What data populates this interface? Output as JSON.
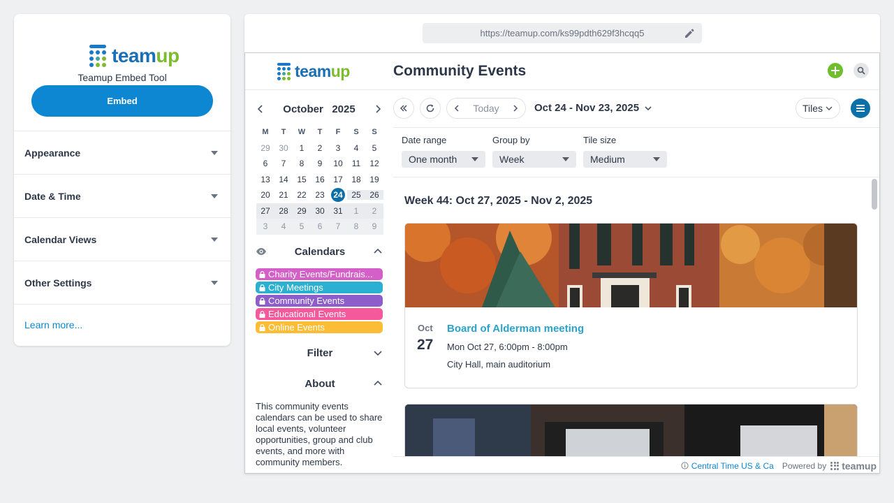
{
  "embed_tool": {
    "logo_text_part1": "team",
    "logo_text_part2": "up",
    "subtitle": "Teamup Embed Tool",
    "embed_label": "Embed",
    "sections": [
      {
        "label": "Appearance"
      },
      {
        "label": "Date & Time"
      },
      {
        "label": "Calendar Views"
      },
      {
        "label": "Other Settings"
      }
    ],
    "learn_more": "Learn more..."
  },
  "preview": {
    "url": "https://teamup.com/ks99pdth629f3hcqq5"
  },
  "calendar": {
    "title": "Community Events",
    "mini_cal": {
      "month": "October",
      "year": "2025",
      "dow": [
        "M",
        "T",
        "W",
        "T",
        "F",
        "S",
        "S"
      ],
      "weeks": [
        [
          "29",
          "30",
          "1",
          "2",
          "3",
          "4",
          "5"
        ],
        [
          "6",
          "7",
          "8",
          "9",
          "10",
          "11",
          "12"
        ],
        [
          "13",
          "14",
          "15",
          "16",
          "17",
          "18",
          "19"
        ],
        [
          "20",
          "21",
          "22",
          "23",
          "24",
          "25",
          "26"
        ],
        [
          "27",
          "28",
          "29",
          "30",
          "31",
          "1",
          "2"
        ],
        [
          "3",
          "4",
          "5",
          "6",
          "7",
          "8",
          "9"
        ]
      ],
      "today": "24"
    },
    "calendars_heading": "Calendars",
    "calendars": [
      {
        "label": "Charity Events/Fundrais...",
        "color": "#d45fc9"
      },
      {
        "label": "City Meetings",
        "color": "#2cb0d2"
      },
      {
        "label": "Community Events",
        "color": "#8d5dc9"
      },
      {
        "label": "Educational Events",
        "color": "#f5589b"
      },
      {
        "label": "Online Events",
        "color": "#fcbd36"
      }
    ],
    "filter_heading": "Filter",
    "about_heading": "About",
    "about_text": "This community events calendars can be used to share local events, volunteer opportunities, group and club events, and more with community members.",
    "toolbar": {
      "today_label": "Today",
      "date_range": "Oct 24 - Nov 23, 2025",
      "view_label": "Tiles"
    },
    "options": {
      "date_range_label": "Date range",
      "date_range_value": "One month",
      "group_by_label": "Group by",
      "group_by_value": "Week",
      "tile_size_label": "Tile size",
      "tile_size_value": "Medium"
    },
    "week_heading": "Week 44: Oct 27, 2025 - Nov 2, 2025",
    "event": {
      "month": "Oct",
      "day": "27",
      "title": "Board of Alderman meeting",
      "time": "Mon Oct 27, 6:00pm - 8:00pm",
      "location": "City Hall, main auditorium"
    },
    "footer": {
      "timezone": "Central Time US & Ca",
      "powered_by": "Powered by",
      "brand": "teamup"
    }
  },
  "colors": {
    "primary": "#0d87d1",
    "today_highlight": "#0d6fa8",
    "add_button": "#6fbe2d",
    "event_title": "#2ba3c9"
  }
}
